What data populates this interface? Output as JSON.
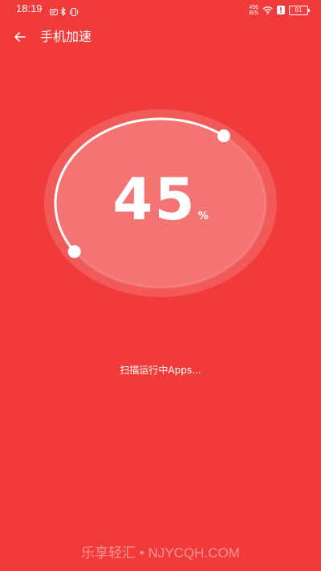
{
  "status_bar": {
    "time": "18:19",
    "net_speed_value": "456",
    "net_speed_unit": "B/S",
    "battery_level": "81"
  },
  "header": {
    "title": "手机加速"
  },
  "gauge": {
    "value": "45",
    "unit": "%",
    "progress_fraction": 0.45
  },
  "scan": {
    "status_text": "扫描运行中Apps..."
  },
  "watermark": {
    "text": "乐享轻汇 • NJYCQH.COM"
  },
  "colors": {
    "background": "#f03b3a",
    "foreground": "#ffffff"
  },
  "icons": {
    "back": "arrow-left-icon",
    "bluetooth": "bluetooth-icon",
    "wifi": "wifi-icon",
    "vibrate": "vibrate-icon"
  }
}
